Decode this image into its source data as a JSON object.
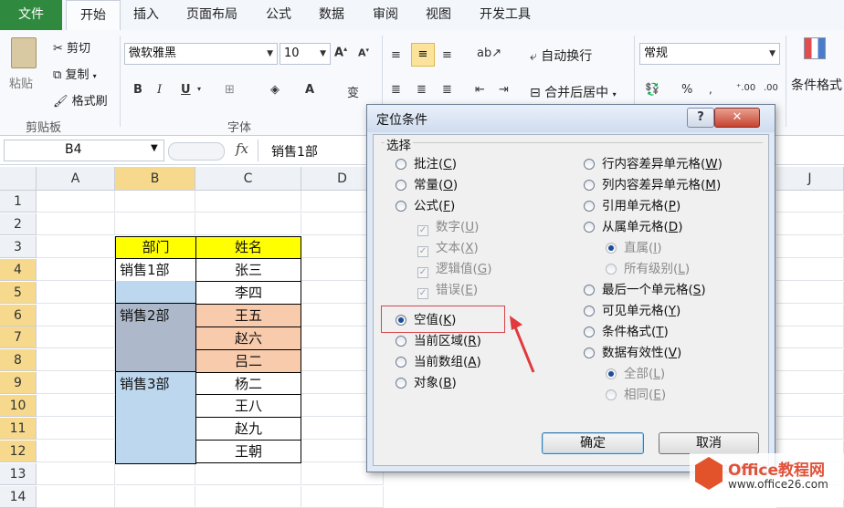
{
  "tabs": [
    "文件",
    "开始",
    "插入",
    "页面布局",
    "公式",
    "数据",
    "审阅",
    "视图",
    "开发工具"
  ],
  "clipboard": {
    "paste": "粘贴",
    "cut": "剪切",
    "copy": "复制",
    "format_painter": "格式刷",
    "group": "剪贴板"
  },
  "font": {
    "name": "微软雅黑",
    "size": "10",
    "group": "字体"
  },
  "alignment": {
    "wrap": "自动换行",
    "merge": "合并后居中"
  },
  "number": {
    "format": "常规",
    "percent": "%"
  },
  "styles": {
    "conditional": "条件格式"
  },
  "formula_bar": {
    "name_box": "B4",
    "fx": "fx",
    "value": "销售1部"
  },
  "columns": [
    "A",
    "B",
    "C",
    "D",
    "J"
  ],
  "rows": [
    "1",
    "2",
    "3",
    "4",
    "5",
    "6",
    "7",
    "8",
    "9",
    "10",
    "11",
    "12",
    "13",
    "14"
  ],
  "table": {
    "headers": [
      "部门",
      "姓名"
    ],
    "depts": [
      "销售1部",
      "销售2部",
      "销售3部"
    ],
    "names": [
      "张三",
      "李四",
      "王五",
      "赵六",
      "吕二",
      "杨二",
      "王八",
      "赵九",
      "王朝"
    ]
  },
  "dialog": {
    "title": "定位条件",
    "help": "?",
    "section": "选择",
    "left": [
      {
        "label": "批注",
        "key": "C"
      },
      {
        "label": "常量",
        "key": "O"
      },
      {
        "label": "公式",
        "key": "F"
      },
      {
        "label": "数字",
        "key": "U"
      },
      {
        "label": "文本",
        "key": "X"
      },
      {
        "label": "逻辑值",
        "key": "G"
      },
      {
        "label": "错误",
        "key": "E"
      },
      {
        "label": "空值",
        "key": "K"
      },
      {
        "label": "当前区域",
        "key": "R"
      },
      {
        "label": "当前数组",
        "key": "A"
      },
      {
        "label": "对象",
        "key": "B"
      }
    ],
    "right": [
      {
        "label": "行内容差异单元格",
        "key": "W"
      },
      {
        "label": "列内容差异单元格",
        "key": "M"
      },
      {
        "label": "引用单元格",
        "key": "P"
      },
      {
        "label": "从属单元格",
        "key": "D"
      },
      {
        "label": "直属",
        "key": "I"
      },
      {
        "label": "所有级别",
        "key": "L"
      },
      {
        "label": "最后一个单元格",
        "key": "S"
      },
      {
        "label": "可见单元格",
        "key": "Y"
      },
      {
        "label": "条件格式",
        "key": "T"
      },
      {
        "label": "数据有效性",
        "key": "V"
      },
      {
        "label": "全部",
        "key": "L"
      },
      {
        "label": "相同",
        "key": "E"
      }
    ],
    "selected": "空值",
    "ok": "确定",
    "cancel": "取消"
  },
  "watermark": {
    "brand": "Office教程网",
    "url": "www.office26.com"
  },
  "colors": {
    "header_fill": "#ffff00",
    "blue_fill": "#bdd7ee",
    "gray_fill": "#adb9ca",
    "peach_fill": "#f8cbad",
    "file_tab": "#2f8a3f",
    "accent_red": "#e0393e"
  }
}
